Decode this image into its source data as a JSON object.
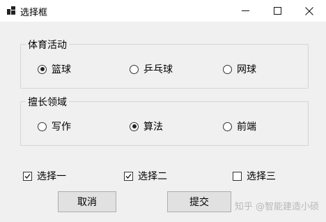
{
  "window": {
    "title": "选择框",
    "app_icon": "app-window-icon",
    "minimize_icon": "minimize-icon",
    "maximize_icon": "maximize-icon",
    "close_icon": "close-icon"
  },
  "group_sports": {
    "title": "体育活动",
    "options": [
      {
        "label": "篮球",
        "checked": true
      },
      {
        "label": "乒乓球",
        "checked": false
      },
      {
        "label": "网球",
        "checked": false
      }
    ]
  },
  "group_skills": {
    "title": "擅长领域",
    "options": [
      {
        "label": "写作",
        "checked": false
      },
      {
        "label": "算法",
        "checked": true
      },
      {
        "label": "前端",
        "checked": false
      }
    ]
  },
  "checkboxes": [
    {
      "label": "选择一",
      "checked": true
    },
    {
      "label": "选择二",
      "checked": true
    },
    {
      "label": "选择三",
      "checked": false
    }
  ],
  "buttons": {
    "cancel": "取消",
    "submit": "提交"
  },
  "watermark": "知乎 @智能建造小硕"
}
